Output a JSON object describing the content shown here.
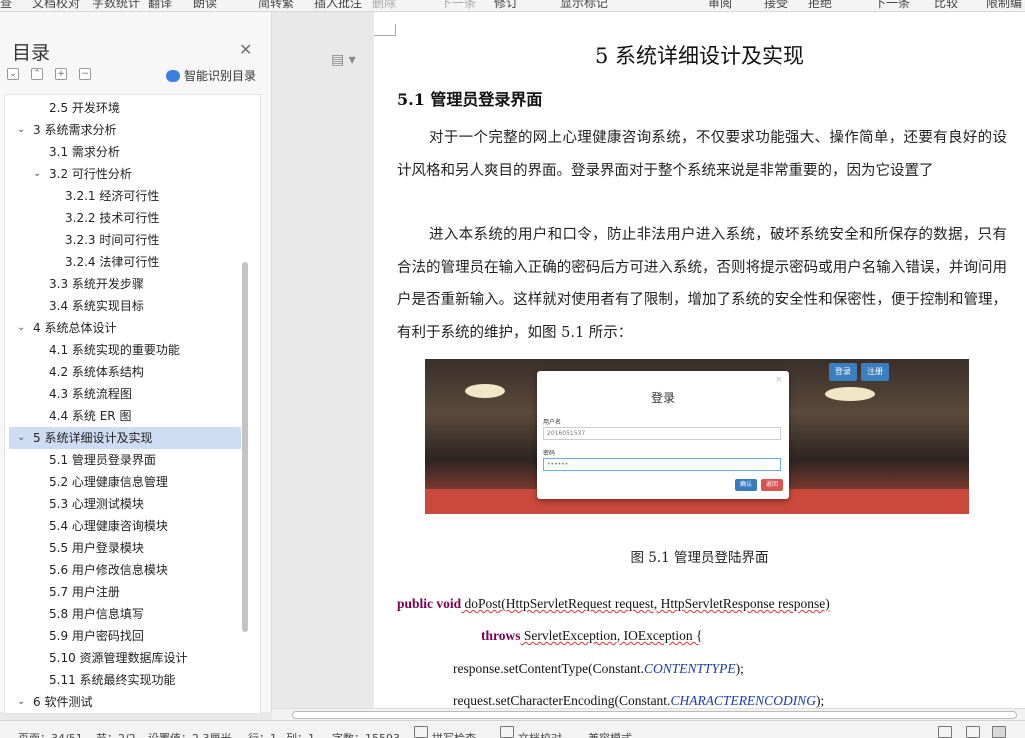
{
  "toolbar": {
    "items": [
      "查",
      "文档校对",
      "字数统计",
      "翻译",
      "朗读",
      "简转繁",
      "插入批注",
      "删除",
      "下一条",
      "修订",
      "显示标记",
      "审阅",
      "接受",
      "拒绝",
      "下一条",
      "比较",
      "限制编"
    ]
  },
  "sidebar": {
    "title": "目录",
    "ai_label": "智能识别目录",
    "toc": [
      {
        "label": "2.5   开发环境",
        "level": 2
      },
      {
        "label": "3    系统需求分析",
        "level": 1
      },
      {
        "label": "3.1   需求分析",
        "level": 2
      },
      {
        "label": "3.2   可行性分析",
        "level": 2
      },
      {
        "label": "3.2.1   经济可行性",
        "level": 3
      },
      {
        "label": "3.2.2   技术可行性",
        "level": 3
      },
      {
        "label": "3.2.3   时间可行性",
        "level": 3
      },
      {
        "label": "3.2.4   法律可行性",
        "level": 3
      },
      {
        "label": "3.3   系统开发步骤",
        "level": 2
      },
      {
        "label": "3.4   系统实现目标",
        "level": 2
      },
      {
        "label": "4    系统总体设计",
        "level": 1
      },
      {
        "label": "4.1   系统实现的重要功能",
        "level": 2
      },
      {
        "label": "4.2   系统体系结构",
        "level": 2
      },
      {
        "label": "4.3   系统流程图",
        "level": 2
      },
      {
        "label": "4.4   系统 ER 图",
        "level": 2
      },
      {
        "label": "5    系统详细设计及实现",
        "level": 1,
        "selected": true
      },
      {
        "label": "5.1   管理员登录界面",
        "level": 2
      },
      {
        "label": "5.2   心理健康信息管理",
        "level": 2
      },
      {
        "label": "5.3   心理测试模块",
        "level": 2
      },
      {
        "label": "5.4   心理健康咨询模块",
        "level": 2
      },
      {
        "label": "5.5   用户登录模块",
        "level": 2
      },
      {
        "label": "5.6   用户修改信息模块",
        "level": 2
      },
      {
        "label": "5.7   用户注册",
        "level": 2
      },
      {
        "label": "5.8   用户信息填写",
        "level": 2
      },
      {
        "label": "5.9   用户密码找回",
        "level": 2
      },
      {
        "label": "5.10  资源管理数据库设计",
        "level": 2
      },
      {
        "label": "5.11  系统最终实现功能",
        "level": 2
      },
      {
        "label": "6    软件测试",
        "level": 1
      }
    ]
  },
  "document": {
    "chapter_title": "5    系统详细设计及实现",
    "section_title": "5.1    管理员登录界面",
    "paragraph1": "对于一个完整的网上心理健康咨询系统，不仅要求功能强大、操作简单，还要有良好的设计风格和另人爽目的界面。登录界面对于整个系统来说是非常重要的，因为它设置了",
    "paragraph2": "进入本系统的用户和口令，防止非法用户进入系统，破坏系统安全和所保存的数据，只有合法的管理员在输入正确的密码后方可进入系统，否则将提示密码或用户名输入错误，并询问用户是否重新输入。这样就对使用者有了限制，增加了系统的安全性和保密性，便于控制和管理，有利于系统的维护，如图 5.1 所示：",
    "figure": {
      "btn_login": "登录",
      "btn_register": "注册",
      "modal_title": "登录",
      "username_label": "用户名",
      "username_value": "2016051537",
      "password_label": "密码",
      "password_value": "••••••",
      "ok_button": "确认",
      "back_button": "返回"
    },
    "caption": "图 5.1 管理员登陆界面",
    "code": {
      "l1_kw": "public void",
      "l1_rest": " doPost(HttpServletRequest request, HttpServletResponse response)",
      "l2_kw": "throws",
      "l2_rest": " ServletException, IOException {",
      "l3_pre": "response.setContentType(Constant.",
      "l3_it": "CONTENTTYPE",
      "l3_post": ");",
      "l4_pre": "request.setCharacterEncoding(Constant.",
      "l4_it": "CHARACTERENCODING",
      "l4_post": ");"
    }
  },
  "status": {
    "page": "页面：34/51",
    "section": "节：2/2",
    "setting": "设置值：2.3厘米",
    "row": "行：1",
    "col": "列：1",
    "words": "字数：15593",
    "spellcheck": "拼写检查",
    "doc_check": "文档校对",
    "compat": "兼容模式"
  }
}
